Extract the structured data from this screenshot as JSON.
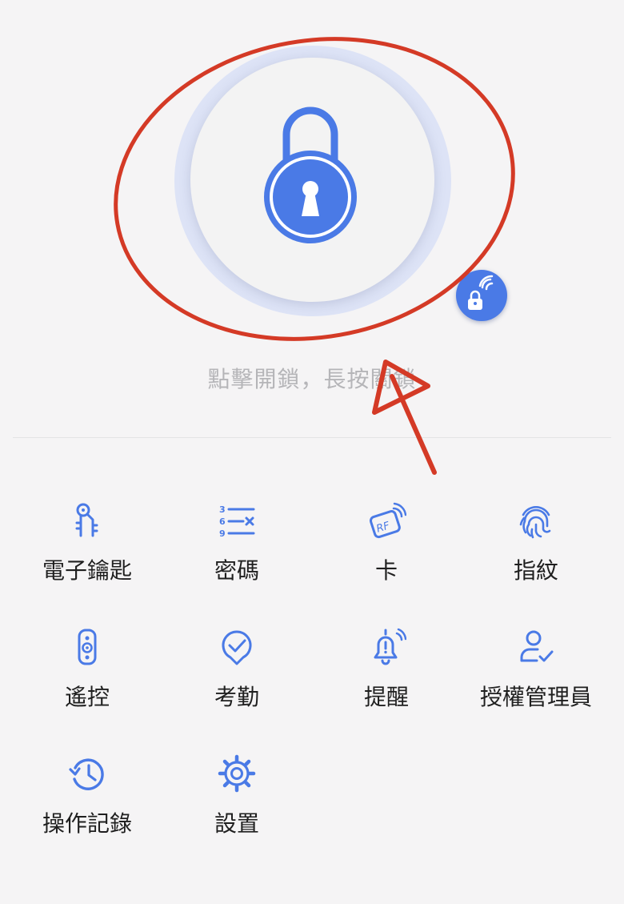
{
  "lock": {
    "hint": "點擊開鎖，長按關鎖",
    "main_icon": "padlock-icon",
    "remote_icon": "wireless-lock-icon"
  },
  "colors": {
    "accent": "#4a7ae6",
    "background": "#f5f4f5",
    "hint_text": "#b5b5b8",
    "annotation": "#d43a26"
  },
  "features": [
    {
      "label": "電子鑰匙",
      "icon": "keys-icon"
    },
    {
      "label": "密碼",
      "icon": "passcode-icon"
    },
    {
      "label": "卡",
      "icon": "rf-card-icon"
    },
    {
      "label": "指紋",
      "icon": "fingerprint-icon"
    },
    {
      "label": "遙控",
      "icon": "remote-control-icon"
    },
    {
      "label": "考勤",
      "icon": "attendance-check-icon"
    },
    {
      "label": "提醒",
      "icon": "alert-bell-icon"
    },
    {
      "label": "授權管理員",
      "icon": "admin-user-icon"
    },
    {
      "label": "操作記錄",
      "icon": "history-clock-icon"
    },
    {
      "label": "設置",
      "icon": "settings-gear-icon"
    }
  ]
}
